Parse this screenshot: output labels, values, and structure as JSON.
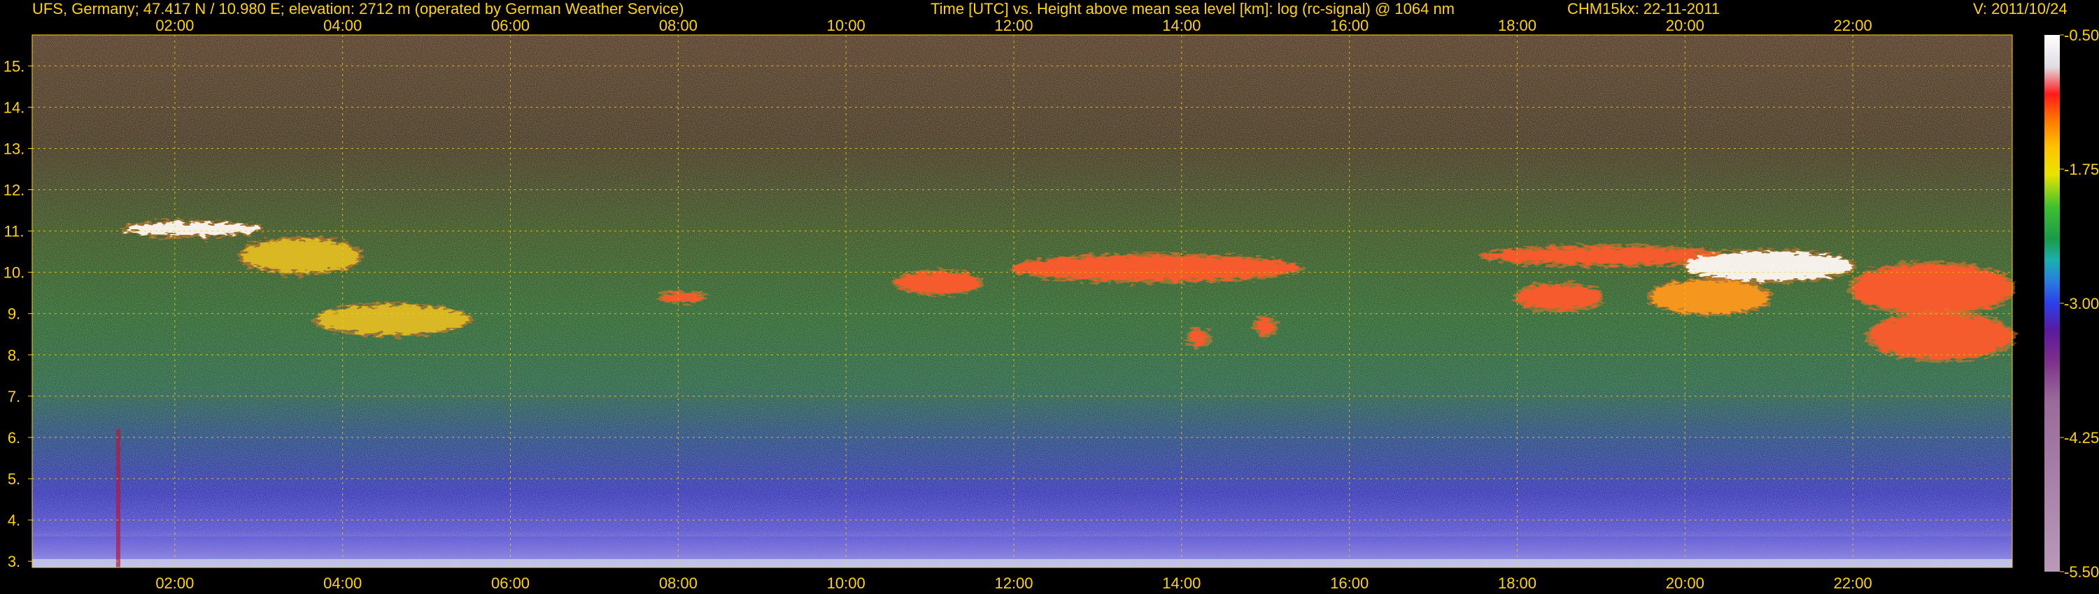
{
  "header": {
    "station": "UFS, Germany; 47.417 N / 10.980 E; elevation: 2712 m  (operated by German Weather Service)",
    "plot_title": "Time [UTC] vs. Height above mean sea level [km]: log (rc-signal) @ 1064 nm",
    "instrument_date": "CHM15kx: 22-11-2011",
    "version": "V: 2011/10/24"
  },
  "colors": {
    "text": "#ffd400",
    "grid": "#ffd400",
    "background": "#000000"
  },
  "chart_data": {
    "type": "heatmap",
    "title": "Time [UTC] vs. Height above mean sea level [km]: log (rc-signal) @ 1064 nm",
    "xlabel": "Time [UTC]",
    "ylabel": "Height above mean sea level [km]",
    "x_unit": "hours UTC",
    "xlim": [
      0.3,
      23.9
    ],
    "ylim": [
      2.85,
      15.75
    ],
    "x_ticks": [
      2,
      4,
      6,
      8,
      10,
      12,
      14,
      16,
      18,
      20,
      22
    ],
    "x_tick_labels": [
      "02:00",
      "04:00",
      "06:00",
      "08:00",
      "10:00",
      "12:00",
      "14:00",
      "16:00",
      "18:00",
      "20:00",
      "22:00"
    ],
    "y_ticks": [
      3,
      4,
      5,
      6,
      7,
      8,
      9,
      10,
      11,
      12,
      13,
      14,
      15
    ],
    "y_tick_labels": [
      "3.",
      "4.",
      "5.",
      "6.",
      "7.",
      "8.",
      "9.",
      "10.",
      "11.",
      "12.",
      "13.",
      "14.",
      "15."
    ],
    "grid": true,
    "colorbar": {
      "range": [
        -5.5,
        -0.5
      ],
      "ticks": [
        -0.5,
        -1.75,
        -3.0,
        -4.25,
        -5.5
      ],
      "tick_labels": [
        "-0.50",
        "-1.75",
        "-3.00",
        "-4.25",
        "-5.50"
      ]
    },
    "cloud_layers": [
      {
        "t_start": 1.4,
        "t_end": 3.0,
        "h_base": 10.9,
        "h_top": 11.2,
        "intensity": -0.6
      },
      {
        "t_start": 2.8,
        "t_end": 4.2,
        "h_base": 10.0,
        "h_top": 10.8,
        "intensity": -1.5
      },
      {
        "t_start": 3.7,
        "t_end": 5.5,
        "h_base": 8.5,
        "h_top": 9.2,
        "intensity": -1.6
      },
      {
        "t_start": 7.8,
        "t_end": 8.3,
        "h_base": 9.3,
        "h_top": 9.5,
        "intensity": -1.0
      },
      {
        "t_start": 10.6,
        "t_end": 11.6,
        "h_base": 9.5,
        "h_top": 10.0,
        "intensity": -1.0
      },
      {
        "t_start": 12.0,
        "t_end": 15.4,
        "h_base": 9.8,
        "h_top": 10.4,
        "intensity": -0.8
      },
      {
        "t_start": 14.1,
        "t_end": 14.3,
        "h_base": 8.2,
        "h_top": 8.6,
        "intensity": -1.0
      },
      {
        "t_start": 14.9,
        "t_end": 15.1,
        "h_base": 8.5,
        "h_top": 8.9,
        "intensity": -1.0
      },
      {
        "t_start": 17.6,
        "t_end": 20.5,
        "h_base": 10.2,
        "h_top": 10.6,
        "intensity": -1.0
      },
      {
        "t_start": 18.0,
        "t_end": 19.0,
        "h_base": 9.1,
        "h_top": 9.7,
        "intensity": -0.9
      },
      {
        "t_start": 19.6,
        "t_end": 21.0,
        "h_base": 9.0,
        "h_top": 9.8,
        "intensity": -1.2
      },
      {
        "t_start": 20.0,
        "t_end": 22.0,
        "h_base": 9.8,
        "h_top": 10.5,
        "intensity": -0.7
      },
      {
        "t_start": 22.0,
        "t_end": 23.9,
        "h_base": 9.0,
        "h_top": 10.2,
        "intensity": -0.9
      },
      {
        "t_start": 22.2,
        "t_end": 23.9,
        "h_base": 7.9,
        "h_top": 9.0,
        "intensity": -1.0
      }
    ],
    "boundary_layer": {
      "h_top": 3.6,
      "intensity": -3.5
    }
  }
}
